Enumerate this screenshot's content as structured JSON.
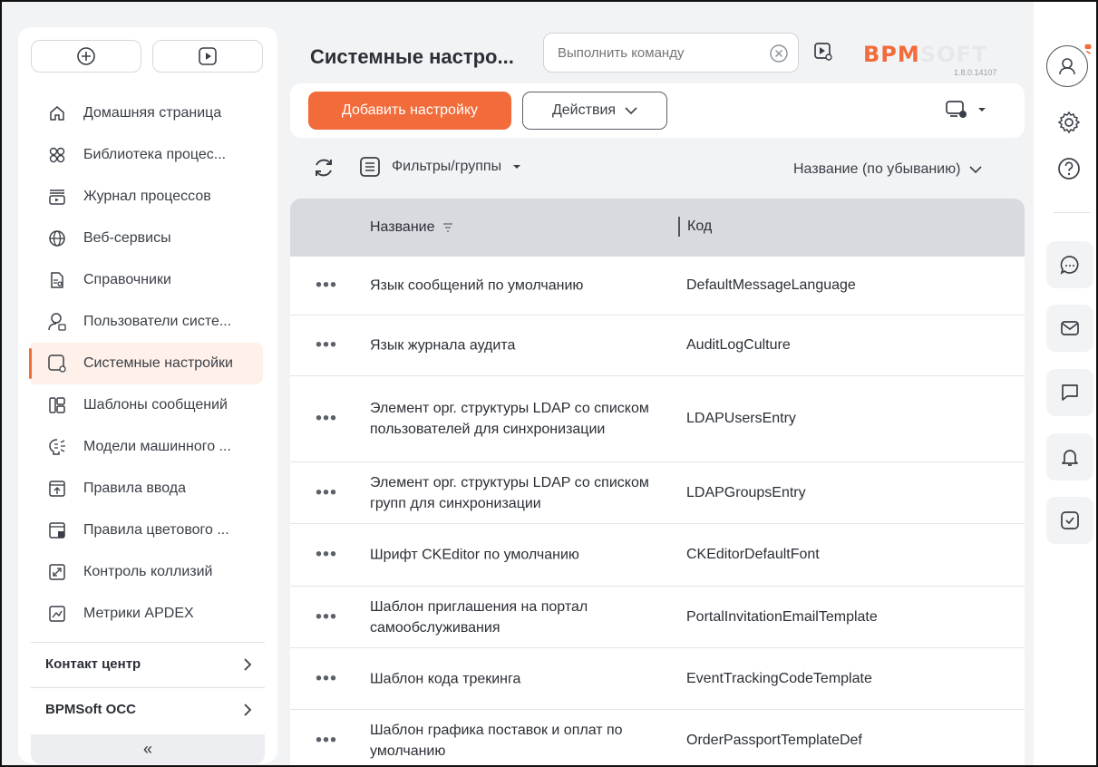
{
  "page": {
    "title": "Системные настро...",
    "command_placeholder": "Выполнить команду",
    "logo_main": "BPM",
    "logo_accent": "SOFT",
    "version": "1.8.0.14107"
  },
  "sidebar": {
    "items": [
      {
        "label": "Домашняя страница",
        "icon": "home-icon"
      },
      {
        "label": "Библиотека процес...",
        "icon": "process-library-icon"
      },
      {
        "label": "Журнал процессов",
        "icon": "process-log-icon"
      },
      {
        "label": "Веб-сервисы",
        "icon": "globe-icon"
      },
      {
        "label": "Справочники",
        "icon": "lookup-icon"
      },
      {
        "label": "Пользователи систе...",
        "icon": "users-icon"
      },
      {
        "label": "Системные настройки",
        "icon": "system-settings-icon",
        "active": true
      },
      {
        "label": "Шаблоны сообщений",
        "icon": "message-templates-icon"
      },
      {
        "label": "Модели машинного ...",
        "icon": "ml-models-icon"
      },
      {
        "label": "Правила ввода",
        "icon": "input-rules-icon"
      },
      {
        "label": "Правила цветового ...",
        "icon": "color-rules-icon"
      },
      {
        "label": "Контроль коллизий",
        "icon": "collision-icon"
      },
      {
        "label": "Метрики APDEX",
        "icon": "apdex-icon"
      }
    ],
    "sections": [
      {
        "label": "Контакт центр"
      },
      {
        "label": "BPMSoft OCC"
      }
    ],
    "collapse_label": "«"
  },
  "toolbar": {
    "add_label": "Добавить настройку",
    "actions_label": "Действия"
  },
  "filters": {
    "filter_label": "Фильтры/группы",
    "sort_label": "Название (по убыванию)"
  },
  "table": {
    "columns": [
      "Название",
      "Код"
    ],
    "rows": [
      {
        "name": "Язык сообщений по умолчанию",
        "code": "DefaultMessageLanguage"
      },
      {
        "name": "Язык журнала аудита",
        "code": "AuditLogCulture"
      },
      {
        "name": "Элемент орг. структуры LDAP со списком пользователей для синхронизации",
        "code": "LDAPUsersEntry"
      },
      {
        "name": "Элемент орг. структуры LDAP со списком групп для синхронизации",
        "code": "LDAPGroupsEntry"
      },
      {
        "name": "Шрифт CKEditor по умолчанию",
        "code": "CKEditorDefaultFont"
      },
      {
        "name": "Шаблон приглашения на портал самообслуживания",
        "code": "PortalInvitationEmailTemplate"
      },
      {
        "name": "Шаблон кода трекинга",
        "code": "EventTrackingCodeTemplate"
      },
      {
        "name": "Шаблон графика поставок и оплат по умолчанию",
        "code": "OrderPassportTemplateDef"
      }
    ]
  },
  "colors": {
    "accent": "#f26b3a",
    "header_bg": "#d8dadf",
    "active_bg": "#fff1ea"
  }
}
